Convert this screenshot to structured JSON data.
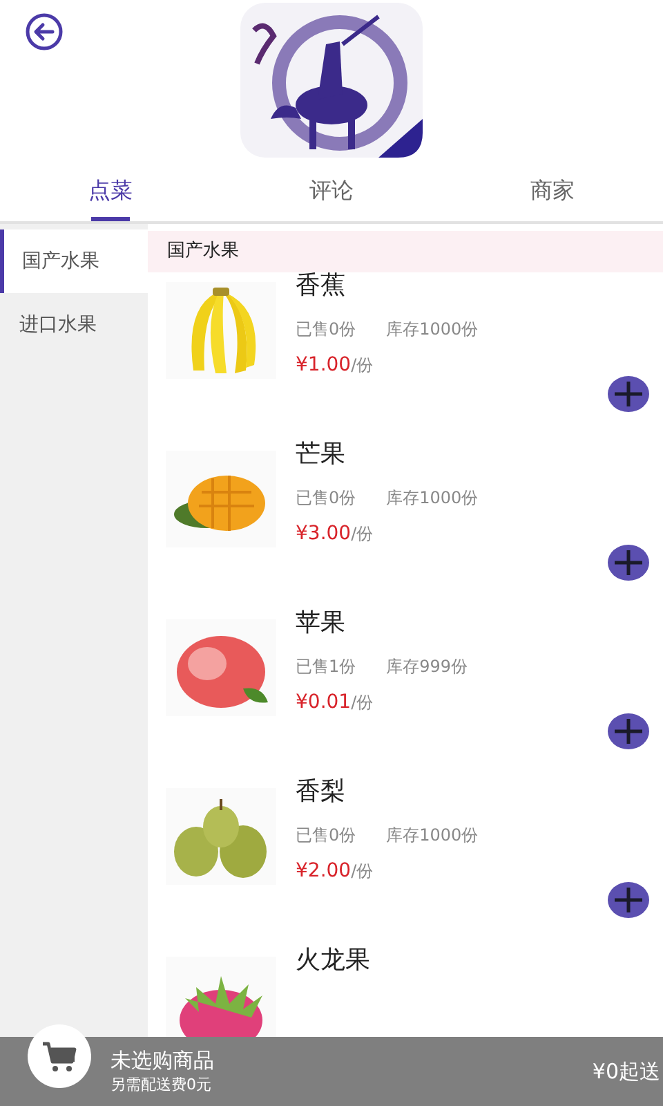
{
  "tabs": [
    {
      "label": "点菜",
      "selected": true
    },
    {
      "label": "评论",
      "selected": false
    },
    {
      "label": "商家",
      "selected": false
    }
  ],
  "sidebar": {
    "items": [
      {
        "label": "国产水果",
        "selected": true
      },
      {
        "label": "进口水果",
        "selected": false
      }
    ]
  },
  "category_title": "国产水果",
  "products": [
    {
      "name": "香蕉",
      "sold": "已售0份",
      "stock": "库存1000份",
      "price": "¥1.00",
      "unit": "/份"
    },
    {
      "name": "芒果",
      "sold": "已售0份",
      "stock": "库存1000份",
      "price": "¥3.00",
      "unit": "/份"
    },
    {
      "name": "苹果",
      "sold": "已售1份",
      "stock": "库存999份",
      "price": "¥0.01",
      "unit": "/份"
    },
    {
      "name": "香梨",
      "sold": "已售0份",
      "stock": "库存1000份",
      "price": "¥2.00",
      "unit": "/份"
    },
    {
      "name": "火龙果"
    }
  ],
  "cart_bar": {
    "title": "未选购商品",
    "subtitle": "另需配送费0元",
    "min_order": "¥0起送"
  }
}
